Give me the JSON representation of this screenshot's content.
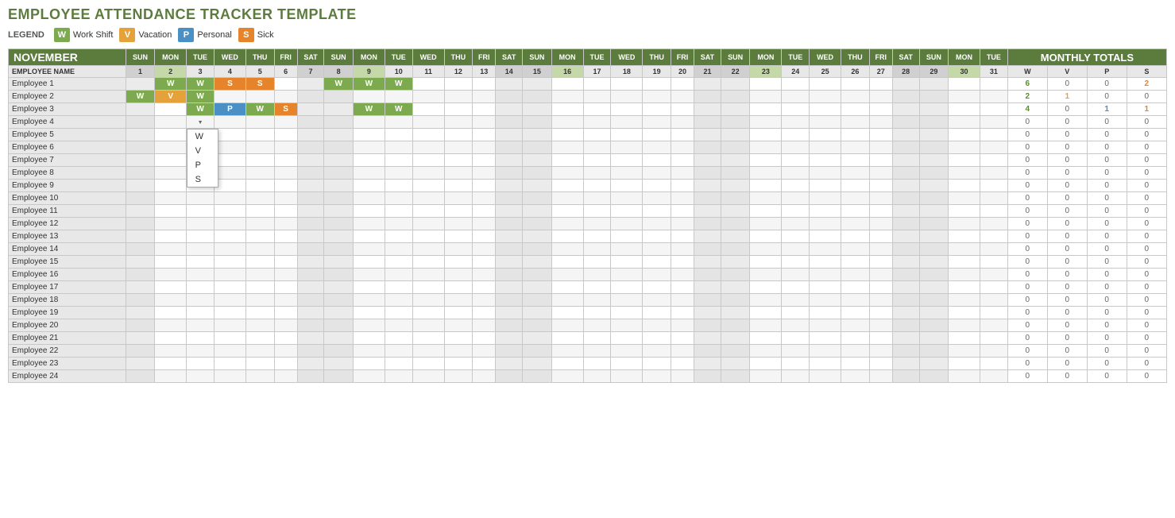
{
  "title": "EMPLOYEE ATTENDANCE TRACKER TEMPLATE",
  "legend": {
    "label": "LEGEND",
    "items": [
      {
        "code": "W",
        "label": "Work Shift",
        "class": "badge-w"
      },
      {
        "code": "V",
        "label": "Vacation",
        "class": "badge-v"
      },
      {
        "code": "P",
        "label": "Personal",
        "class": "badge-p"
      },
      {
        "code": "S",
        "label": "Sick",
        "class": "badge-s"
      }
    ]
  },
  "month": "NOVEMBER",
  "days": [
    {
      "num": 1,
      "day": "SUN"
    },
    {
      "num": 2,
      "day": "MON"
    },
    {
      "num": 3,
      "day": "TUE"
    },
    {
      "num": 4,
      "day": "WED"
    },
    {
      "num": 5,
      "day": "THU"
    },
    {
      "num": 6,
      "day": "FRI"
    },
    {
      "num": 7,
      "day": "SAT"
    },
    {
      "num": 8,
      "day": "SUN"
    },
    {
      "num": 9,
      "day": "MON"
    },
    {
      "num": 10,
      "day": "TUE"
    },
    {
      "num": 11,
      "day": "WED"
    },
    {
      "num": 12,
      "day": "THU"
    },
    {
      "num": 13,
      "day": "FRI"
    },
    {
      "num": 14,
      "day": "SAT"
    },
    {
      "num": 15,
      "day": "SUN"
    },
    {
      "num": 16,
      "day": "MON"
    },
    {
      "num": 17,
      "day": "TUE"
    },
    {
      "num": 18,
      "day": "WED"
    },
    {
      "num": 19,
      "day": "THU"
    },
    {
      "num": 20,
      "day": "FRI"
    },
    {
      "num": 21,
      "day": "SAT"
    },
    {
      "num": 22,
      "day": "SUN"
    },
    {
      "num": 23,
      "day": "MON"
    },
    {
      "num": 24,
      "day": "TUE"
    },
    {
      "num": 25,
      "day": "WED"
    },
    {
      "num": 26,
      "day": "THU"
    },
    {
      "num": 27,
      "day": "FRI"
    },
    {
      "num": 28,
      "day": "SAT"
    },
    {
      "num": 29,
      "day": "SUN"
    },
    {
      "num": 30,
      "day": "MON"
    },
    {
      "num": 31,
      "day": "TUE"
    }
  ],
  "employees": [
    {
      "name": "Employee 1",
      "attendance": {
        "1": "",
        "2": "W",
        "3": "W",
        "4": "S",
        "5": "S",
        "6": "",
        "7": "",
        "8": "W",
        "9": "W",
        "10": "W",
        "11": "",
        "12": "",
        "13": "",
        "14": "",
        "15": "",
        "16": "",
        "17": "",
        "18": "",
        "19": "",
        "20": "",
        "21": "",
        "22": "",
        "23": "",
        "24": "",
        "25": "",
        "26": "",
        "27": "",
        "28": "",
        "29": "",
        "30": "",
        "31": ""
      },
      "totals": {
        "W": 6,
        "V": 0,
        "P": 0,
        "S": 2
      }
    },
    {
      "name": "Employee 2",
      "attendance": {
        "1": "W",
        "2": "V",
        "3": "W",
        "4": "",
        "5": "",
        "6": "",
        "7": "",
        "8": "",
        "9": "",
        "10": "",
        "11": "",
        "12": "",
        "13": "",
        "14": "",
        "15": "",
        "16": "",
        "17": "",
        "18": "",
        "19": "",
        "20": "",
        "21": "",
        "22": "",
        "23": "",
        "24": "",
        "25": "",
        "26": "",
        "27": "",
        "28": "",
        "29": "",
        "30": "",
        "31": ""
      },
      "totals": {
        "W": 2,
        "V": 1,
        "P": 0,
        "S": 0
      }
    },
    {
      "name": "Employee 3",
      "attendance": {
        "1": "",
        "2": "",
        "3": "W",
        "4": "P",
        "5": "W",
        "6": "S",
        "7": "",
        "8": "",
        "9": "W",
        "10": "W",
        "11": "",
        "12": "",
        "13": "",
        "14": "",
        "15": "",
        "16": "",
        "17": "",
        "18": "",
        "19": "",
        "20": "",
        "21": "",
        "22": "",
        "23": "",
        "24": "",
        "25": "",
        "26": "",
        "27": "",
        "28": "",
        "29": "",
        "30": "",
        "31": ""
      },
      "totals": {
        "W": 4,
        "V": 0,
        "P": 1,
        "S": 1
      }
    },
    {
      "name": "Employee 4",
      "attendance": {},
      "totals": {
        "W": 0,
        "V": 0,
        "P": 0,
        "S": 0
      },
      "hasDropdown": true,
      "dropdownCol": 3
    },
    {
      "name": "Employee 5",
      "attendance": {},
      "totals": {
        "W": 0,
        "V": 0,
        "P": 0,
        "S": 0
      }
    },
    {
      "name": "Employee 6",
      "attendance": {},
      "totals": {
        "W": 0,
        "V": 0,
        "P": 0,
        "S": 0
      }
    },
    {
      "name": "Employee 7",
      "attendance": {},
      "totals": {
        "W": 0,
        "V": 0,
        "P": 0,
        "S": 0
      }
    },
    {
      "name": "Employee 8",
      "attendance": {},
      "totals": {
        "W": 0,
        "V": 0,
        "P": 0,
        "S": 0
      }
    },
    {
      "name": "Employee 9",
      "attendance": {},
      "totals": {
        "W": 0,
        "V": 0,
        "P": 0,
        "S": 0
      }
    },
    {
      "name": "Employee 10",
      "attendance": {},
      "totals": {
        "W": 0,
        "V": 0,
        "P": 0,
        "S": 0
      }
    },
    {
      "name": "Employee 11",
      "attendance": {},
      "totals": {
        "W": 0,
        "V": 0,
        "P": 0,
        "S": 0
      }
    },
    {
      "name": "Employee 12",
      "attendance": {},
      "totals": {
        "W": 0,
        "V": 0,
        "P": 0,
        "S": 0
      }
    },
    {
      "name": "Employee 13",
      "attendance": {},
      "totals": {
        "W": 0,
        "V": 0,
        "P": 0,
        "S": 0
      }
    },
    {
      "name": "Employee 14",
      "attendance": {},
      "totals": {
        "W": 0,
        "V": 0,
        "P": 0,
        "S": 0
      }
    },
    {
      "name": "Employee 15",
      "attendance": {},
      "totals": {
        "W": 0,
        "V": 0,
        "P": 0,
        "S": 0
      }
    },
    {
      "name": "Employee 16",
      "attendance": {},
      "totals": {
        "W": 0,
        "V": 0,
        "P": 0,
        "S": 0
      }
    },
    {
      "name": "Employee 17",
      "attendance": {},
      "totals": {
        "W": 0,
        "V": 0,
        "P": 0,
        "S": 0
      }
    },
    {
      "name": "Employee 18",
      "attendance": {},
      "totals": {
        "W": 0,
        "V": 0,
        "P": 0,
        "S": 0
      }
    },
    {
      "name": "Employee 19",
      "attendance": {},
      "totals": {
        "W": 0,
        "V": 0,
        "P": 0,
        "S": 0
      }
    },
    {
      "name": "Employee 20",
      "attendance": {},
      "totals": {
        "W": 0,
        "V": 0,
        "P": 0,
        "S": 0
      }
    },
    {
      "name": "Employee 21",
      "attendance": {},
      "totals": {
        "W": 0,
        "V": 0,
        "P": 0,
        "S": 0
      }
    },
    {
      "name": "Employee 22",
      "attendance": {},
      "totals": {
        "W": 0,
        "V": 0,
        "P": 0,
        "S": 0
      }
    },
    {
      "name": "Employee 23",
      "attendance": {},
      "totals": {
        "W": 0,
        "V": 0,
        "P": 0,
        "S": 0
      }
    },
    {
      "name": "Employee 24",
      "attendance": {},
      "totals": {
        "W": 0,
        "V": 0,
        "P": 0,
        "S": 0
      }
    }
  ],
  "dropdown": {
    "options": [
      "W",
      "V",
      "P",
      "S"
    ],
    "visible": true,
    "row": 4,
    "col": 3
  },
  "monthly_totals_label": "MONTHLY TOTALS",
  "totals_headers": [
    "W",
    "V",
    "P",
    "S"
  ],
  "employee_name_header": "EMPLOYEE NAME",
  "colors": {
    "header_green": "#5b7c3d",
    "w_green": "#7daa4f",
    "v_orange": "#e5a23b",
    "p_blue": "#4a90c4",
    "s_orange2": "#e5842b",
    "mon_bg": "#c5d8a8"
  }
}
